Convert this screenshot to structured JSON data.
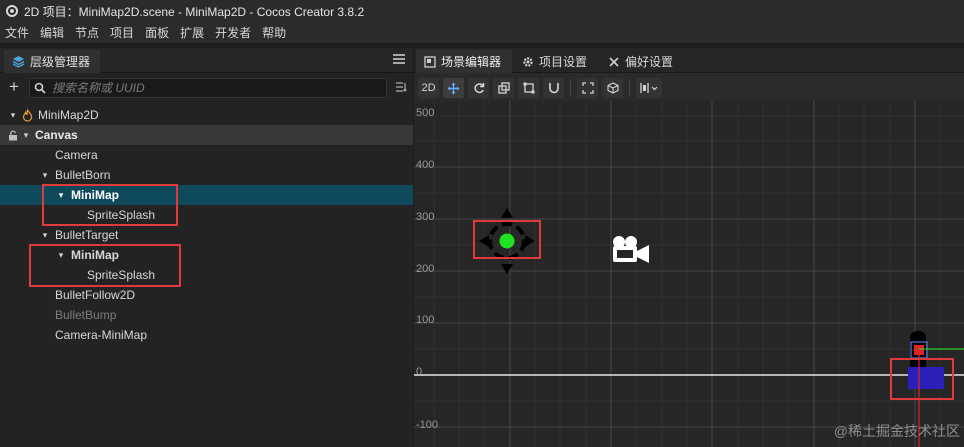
{
  "titlebar": {
    "title": "2D 项目：MiniMap2D.scene - MiniMap2D - Cocos Creator 3.8.2"
  },
  "menubar": {
    "items": [
      "文件",
      "编辑",
      "节点",
      "项目",
      "面板",
      "扩展",
      "开发者",
      "帮助"
    ]
  },
  "hierarchy": {
    "tab_label": "层级管理器",
    "search_placeholder": "搜索名称或 UUID",
    "nodes": [
      {
        "label": "MiniMap2D"
      },
      {
        "label": "Canvas"
      },
      {
        "label": "Camera"
      },
      {
        "label": "BulletBorn"
      },
      {
        "label": "MiniMap"
      },
      {
        "label": "SpriteSplash"
      },
      {
        "label": "BulletTarget"
      },
      {
        "label": "MiniMap"
      },
      {
        "label": "SpriteSplash"
      },
      {
        "label": "BulletFollow2D"
      },
      {
        "label": "BulletBump"
      },
      {
        "label": "Camera-MiniMap"
      }
    ]
  },
  "scene": {
    "tabs": [
      "场景编辑器",
      "项目设置",
      "偏好设置"
    ],
    "toolbar": {
      "mode_2d": "2D"
    },
    "y_labels": [
      "500",
      "400",
      "300",
      "200",
      "100",
      "0",
      "-100"
    ],
    "watermark": "@稀土掘金技术社区"
  },
  "colors": {
    "selected_row": "#0e4a5c",
    "highlight_box": "#e03a3a",
    "accent_blue": "#63b2ff",
    "green_dot": "#1fe31f"
  }
}
